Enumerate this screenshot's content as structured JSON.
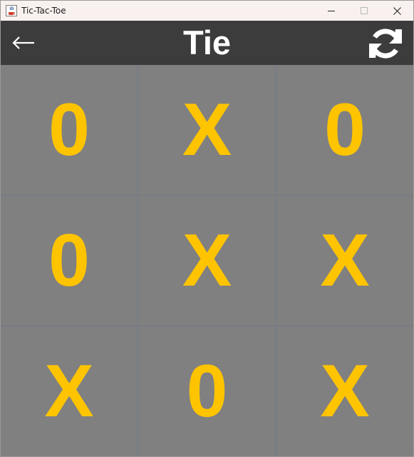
{
  "window": {
    "title": "Tic-Tac-Toe",
    "icon": "java-coffee-icon",
    "controls": [
      "minimize-icon",
      "maximize-icon",
      "close-icon"
    ]
  },
  "header": {
    "back_symbol": "←",
    "status": "Tie",
    "reset_icon": "refresh-icon"
  },
  "board": {
    "cells": [
      "0",
      "X",
      "0",
      "0",
      "X",
      "X",
      "X",
      "0",
      "X"
    ]
  },
  "colors": {
    "header_bg": "#3c3c3c",
    "board_bg": "#808080",
    "mark": "#ffc400",
    "header_text": "#ffffff"
  }
}
